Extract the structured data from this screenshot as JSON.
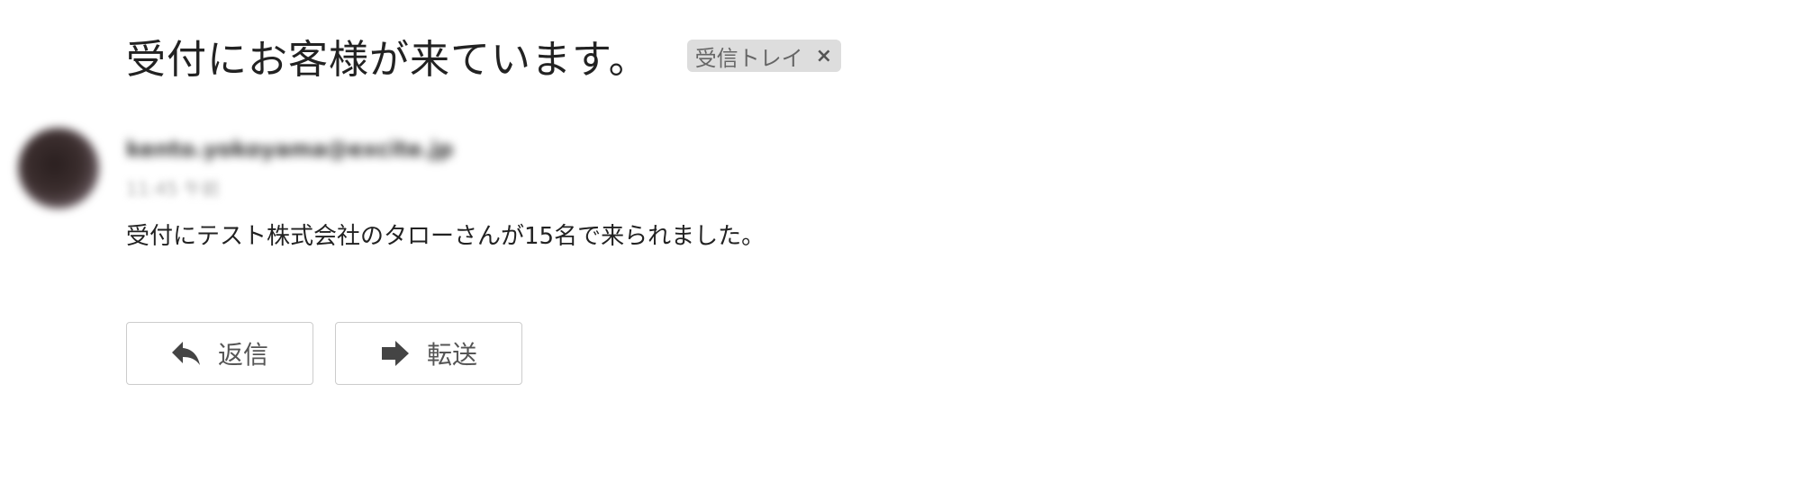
{
  "email": {
    "subject": "受付にお客様が来ています。",
    "label": {
      "name": "受信トレイ",
      "close_symbol": "×"
    },
    "sender": "kento.yokoyama@excite.jp",
    "date": "11:45 午前",
    "body": "受付にテスト株式会社のタローさんが15名で来られました。"
  },
  "actions": {
    "reply": {
      "label": "返信",
      "icon": "reply-arrow-icon"
    },
    "forward": {
      "label": "転送",
      "icon": "forward-arrow-icon"
    }
  },
  "colors": {
    "label_chip_bg": "#dddddd",
    "icon": "#444444",
    "button_border": "#cccccc"
  }
}
